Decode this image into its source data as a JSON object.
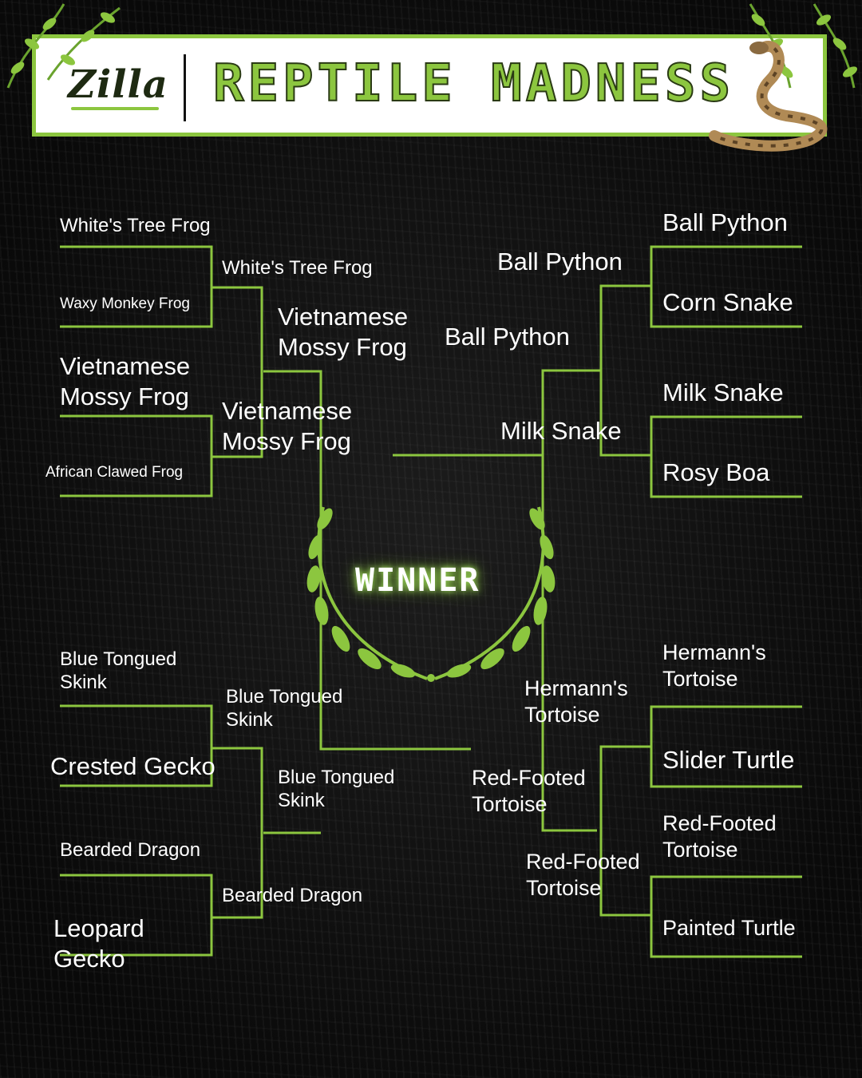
{
  "header": {
    "logo_text": "Zilla",
    "title": "REPTILE MADNESS"
  },
  "colors": {
    "accent": "#8cc63f",
    "background": "#0c0c0c",
    "text": "#ffffff"
  },
  "icons": [
    "vine-icon",
    "snake-icon",
    "laurel-wreath-icon"
  ],
  "winner_label": "WINNER",
  "bracket": {
    "top_left": {
      "round1": [
        "White's Tree Frog",
        "Waxy Monkey Frog",
        "Vietnamese Mossy Frog",
        "African Clawed Frog"
      ],
      "round2": [
        "White's Tree Frog",
        "Vietnamese Mossy Frog"
      ],
      "round3": "Vietnamese Mossy Frog"
    },
    "bottom_left": {
      "round1": [
        "Blue Tongued Skink",
        "Crested Gecko",
        "Bearded Dragon",
        "Leopard Gecko"
      ],
      "round2": [
        "Blue Tongued Skink",
        "Bearded Dragon"
      ],
      "round3": "Blue Tongued Skink"
    },
    "top_right": {
      "round1": [
        "Ball Python",
        "Corn Snake",
        "Milk Snake",
        "Rosy Boa"
      ],
      "round2": [
        "Ball Python",
        "Milk Snake"
      ],
      "round3": "Ball Python"
    },
    "bottom_right": {
      "round1": [
        "Hermann's Tortoise",
        "Slider Turtle",
        "Red-Footed Tortoise",
        "Painted Turtle"
      ],
      "round2": [
        "Hermann's Tortoise",
        "Red-Footed Tortoise"
      ],
      "round3": "Red-Footed Tortoise"
    }
  }
}
